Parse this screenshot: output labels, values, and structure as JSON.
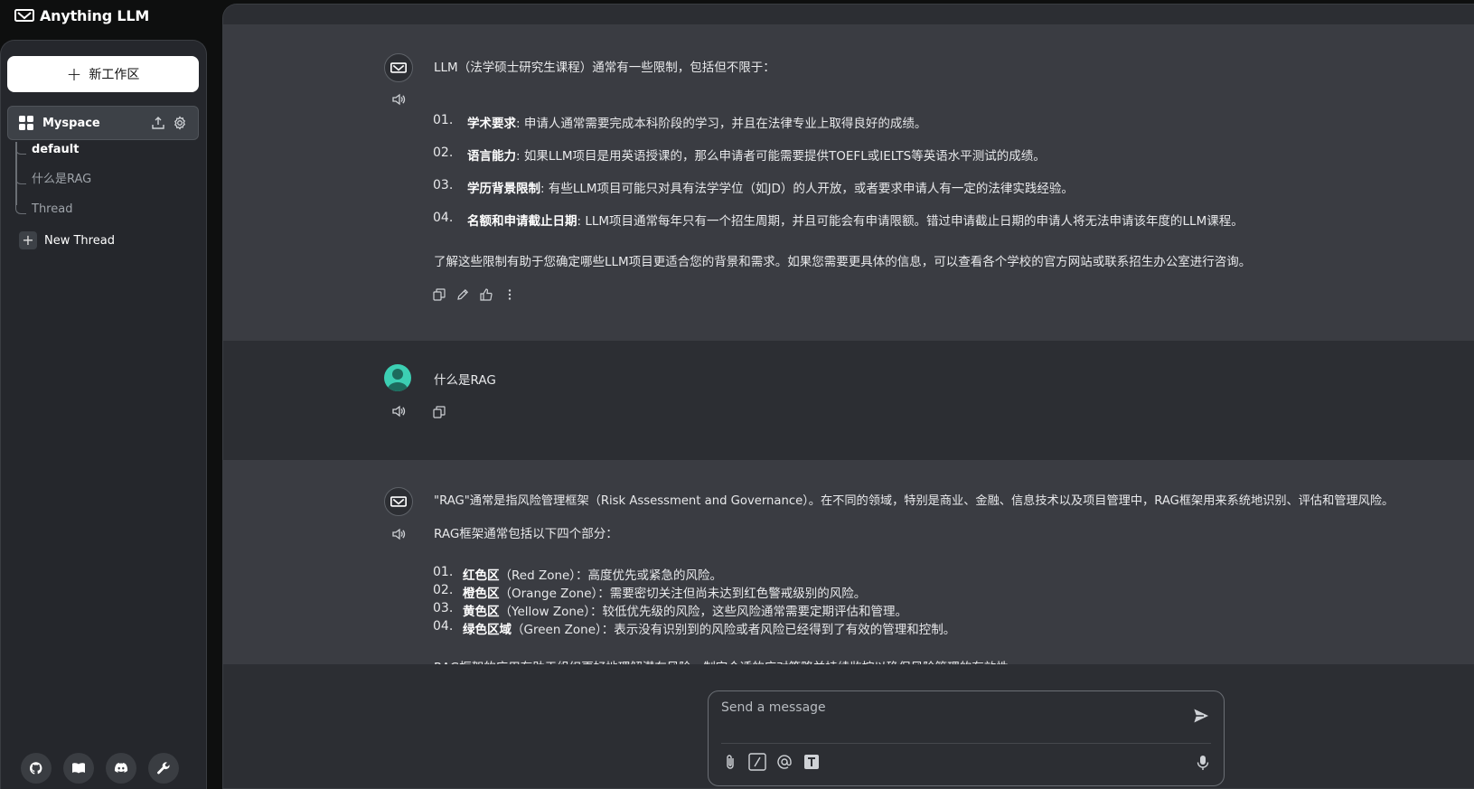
{
  "app": {
    "title": "Anything LLM"
  },
  "sidebar": {
    "new_workspace_label": "新工作区",
    "workspace": {
      "name": "Myspace"
    },
    "threads": [
      {
        "label": "default",
        "active": true
      },
      {
        "label": "什么是RAG",
        "active": false
      },
      {
        "label": "Thread",
        "active": false
      }
    ],
    "new_thread_label": "New Thread",
    "footer_icons": [
      "github-icon",
      "docs-book-icon",
      "discord-icon",
      "settings-wrench-icon"
    ]
  },
  "chat": {
    "messages": [
      {
        "role": "assistant",
        "intro": "LLM（法学硕士研究生课程）通常有一些限制，包括但不限于：",
        "items": [
          {
            "num": "01.",
            "title": "学术要求",
            "text": ": 申请人通常需要完成本科阶段的学习，并且在法律专业上取得良好的成绩。"
          },
          {
            "num": "02.",
            "title": "语言能力",
            "text": ": 如果LLM项目是用英语授课的，那么申请者可能需要提供TOEFL或IELTS等英语水平测试的成绩。"
          },
          {
            "num": "03.",
            "title": "学历背景限制",
            "text": ": 有些LLM项目可能只对具有法学学位（如JD）的人开放，或者要求申请人有一定的法律实践经验。"
          },
          {
            "num": "04.",
            "title": "名额和申请截止日期",
            "text": ": LLM项目通常每年只有一个招生周期，并且可能会有申请限额。错过申请截止日期的申请人将无法申请该年度的LLM课程。"
          }
        ],
        "outro": "了解这些限制有助于您确定哪些LLM项目更适合您的背景和需求。如果您需要更具体的信息，可以查看各个学校的官方网站或联系招生办公室进行咨询。"
      },
      {
        "role": "user",
        "text": "什么是RAG"
      },
      {
        "role": "assistant",
        "intro": "\"RAG\"通常是指风险管理框架（Risk Assessment and Governance）。在不同的领域，特别是商业、金融、信息技术以及项目管理中，RAG框架用来系统地识别、评估和管理风险。",
        "sub_intro": "RAG框架通常包括以下四个部分：",
        "items": [
          {
            "num": "01.",
            "title": "红色区",
            "text": "（Red Zone）：高度优先或紧急的风险。"
          },
          {
            "num": "02.",
            "title": "橙色区",
            "text": "（Orange Zone）：需要密切关注但尚未达到红色警戒级别的风险。"
          },
          {
            "num": "03.",
            "title": "黄色区",
            "text": "（Yellow Zone）：较低优先级的风险，这些风险通常需要定期评估和管理。"
          },
          {
            "num": "04.",
            "title": "绿色区域",
            "text": "（Green Zone）：表示没有识别到的风险或者风险已经得到了有效的管理和控制。"
          }
        ],
        "outro": "RAG框架的应用有助于组织更好地理解潜在风险，制定合适的应对策略并持续监控以确保风险管理的有效性。"
      }
    ]
  },
  "composer": {
    "placeholder": "Send a message"
  },
  "colors": {
    "app_bg": "#0e0f0f",
    "sidebar_bg": "#25272c",
    "main_bg": "#2c2e33",
    "assistant_bg": "#3a3c42",
    "user_avatar": "#3ccfb3"
  }
}
